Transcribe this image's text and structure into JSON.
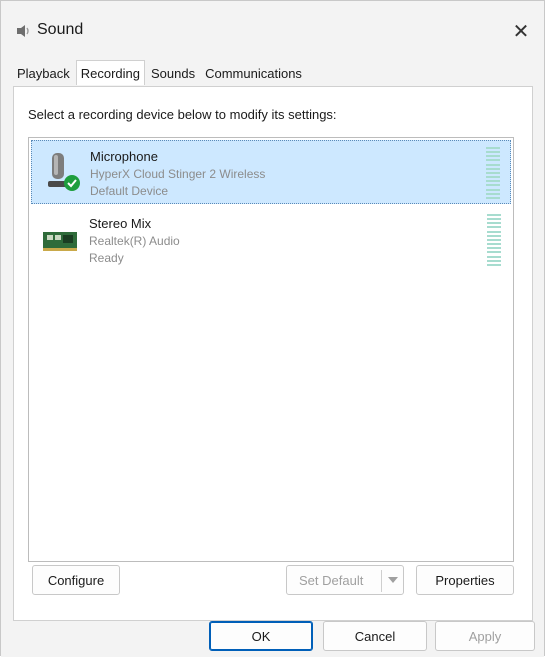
{
  "window": {
    "title": "Sound"
  },
  "tabs": [
    {
      "label": "Playback",
      "active": false
    },
    {
      "label": "Recording",
      "active": true
    },
    {
      "label": "Sounds",
      "active": false
    },
    {
      "label": "Communications",
      "active": false
    }
  ],
  "recording": {
    "instruction": "Select a recording device below to modify its settings:",
    "devices": [
      {
        "name": "Microphone",
        "description": "HyperX Cloud Stinger 2 Wireless",
        "status": "Default Device",
        "icon": "microphone-icon",
        "badge": "default-device-check-icon",
        "selected": true
      },
      {
        "name": "Stereo Mix",
        "description": "Realtek(R) Audio",
        "status": "Ready",
        "icon": "sound-card-icon",
        "selected": false
      }
    ],
    "configure_label": "Configure",
    "set_default_label": "Set Default",
    "properties_label": "Properties"
  },
  "footer": {
    "ok_label": "OK",
    "cancel_label": "Cancel",
    "apply_label": "Apply"
  },
  "colors": {
    "selection_bg": "#cde8ff",
    "level_meter": "#a7dccf",
    "check_badge": "#1e9e3e",
    "primary_border": "#005fb8"
  }
}
